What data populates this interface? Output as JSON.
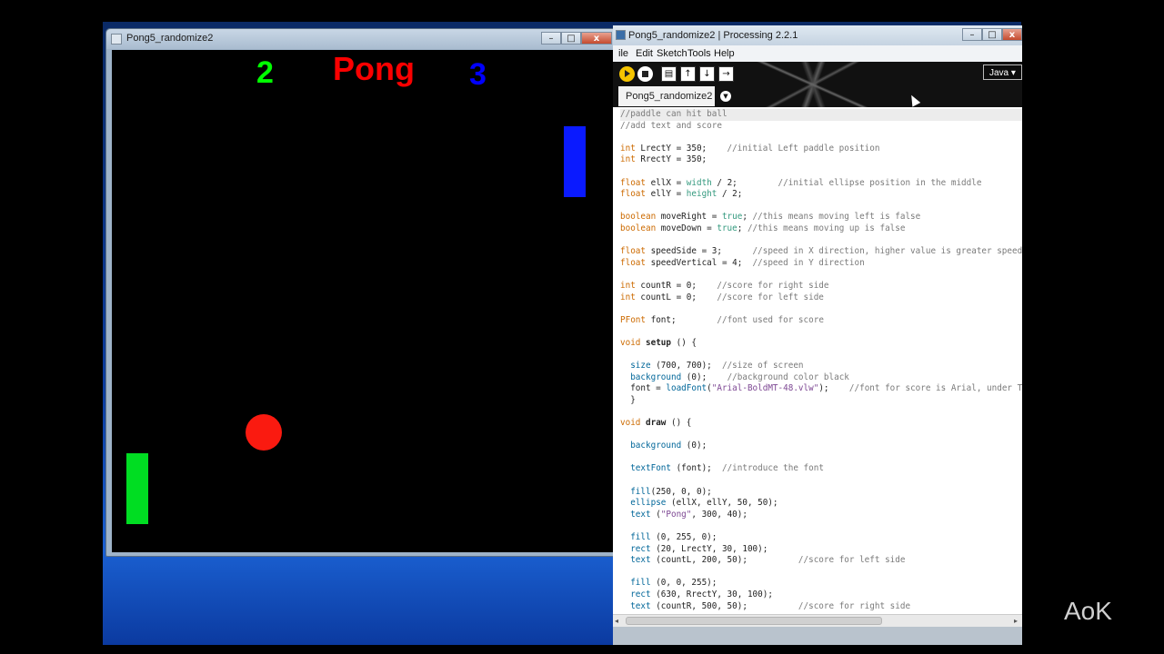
{
  "sketch_window": {
    "title": "Pong5_randomize2"
  },
  "game": {
    "title": "Pong",
    "score_left": "2",
    "score_right": "3"
  },
  "ide": {
    "title": "Pong5_randomize2 | Processing 2.2.1",
    "menu": [
      "ile",
      "Edit",
      "Sketch",
      "Tools",
      "Help"
    ],
    "mode": "Java ▾",
    "tab": "Pong5_randomize2",
    "code_lines": [
      [
        [
          "comment",
          "//paddle can hit ball"
        ]
      ],
      [
        [
          "comment",
          "//add text and score"
        ]
      ],
      [],
      [
        [
          "kw",
          "int"
        ],
        [
          "plain",
          " LrectY = 350;    "
        ],
        [
          "comment",
          "//initial Left paddle position"
        ]
      ],
      [
        [
          "kw",
          "int"
        ],
        [
          "plain",
          " RrectY = 350;"
        ]
      ],
      [],
      [
        [
          "kw",
          "float"
        ],
        [
          "plain",
          " ellX = "
        ],
        [
          "val",
          "width"
        ],
        [
          "plain",
          " / 2;        "
        ],
        [
          "comment",
          "//initial ellipse position in the middle"
        ]
      ],
      [
        [
          "kw",
          "float"
        ],
        [
          "plain",
          " ellY = "
        ],
        [
          "val",
          "height"
        ],
        [
          "plain",
          " / 2;"
        ]
      ],
      [],
      [
        [
          "kw",
          "boolean"
        ],
        [
          "plain",
          " moveRight = "
        ],
        [
          "val",
          "true"
        ],
        [
          "plain",
          "; "
        ],
        [
          "comment",
          "//this means moving left is false"
        ]
      ],
      [
        [
          "kw",
          "boolean"
        ],
        [
          "plain",
          " moveDown = "
        ],
        [
          "val",
          "true"
        ],
        [
          "plain",
          "; "
        ],
        [
          "comment",
          "//this means moving up is false"
        ]
      ],
      [],
      [
        [
          "kw",
          "float"
        ],
        [
          "plain",
          " speedSide = 3;      "
        ],
        [
          "comment",
          "//speed in X direction, higher value is greater speed"
        ]
      ],
      [
        [
          "kw",
          "float"
        ],
        [
          "plain",
          " speedVertical = 4;  "
        ],
        [
          "comment",
          "//speed in Y direction"
        ]
      ],
      [],
      [
        [
          "kw",
          "int"
        ],
        [
          "plain",
          " countR = 0;    "
        ],
        [
          "comment",
          "//score for right side"
        ]
      ],
      [
        [
          "kw",
          "int"
        ],
        [
          "plain",
          " countL = 0;    "
        ],
        [
          "comment",
          "//score for left side"
        ]
      ],
      [],
      [
        [
          "kw",
          "PFont"
        ],
        [
          "plain",
          " font;        "
        ],
        [
          "comment",
          "//font used for score"
        ]
      ],
      [],
      [
        [
          "kw",
          "void"
        ],
        [
          "plain",
          " "
        ],
        [
          "bold",
          "setup"
        ],
        [
          "plain",
          " () {"
        ]
      ],
      [],
      [
        [
          "plain",
          "  "
        ],
        [
          "fn",
          "size"
        ],
        [
          "plain",
          " (700, 700);  "
        ],
        [
          "comment",
          "//size of screen"
        ]
      ],
      [
        [
          "plain",
          "  "
        ],
        [
          "fn",
          "background"
        ],
        [
          "plain",
          " (0);    "
        ],
        [
          "comment",
          "//background color black"
        ]
      ],
      [
        [
          "plain",
          "  font = "
        ],
        [
          "fn",
          "loadFont"
        ],
        [
          "plain",
          "("
        ],
        [
          "str",
          "\"Arial-BoldMT-48.vlw\""
        ],
        [
          "plain",
          ");    "
        ],
        [
          "comment",
          "//font for score is Arial, under Tools"
        ]
      ],
      [
        [
          "plain",
          "  }"
        ]
      ],
      [],
      [
        [
          "kw",
          "void"
        ],
        [
          "plain",
          " "
        ],
        [
          "bold",
          "draw"
        ],
        [
          "plain",
          " () {"
        ]
      ],
      [],
      [
        [
          "plain",
          "  "
        ],
        [
          "fn",
          "background"
        ],
        [
          "plain",
          " (0);"
        ]
      ],
      [],
      [
        [
          "plain",
          "  "
        ],
        [
          "fn",
          "textFont"
        ],
        [
          "plain",
          " (font);  "
        ],
        [
          "comment",
          "//introduce the font"
        ]
      ],
      [],
      [
        [
          "plain",
          "  "
        ],
        [
          "fn",
          "fill"
        ],
        [
          "plain",
          "(250, 0, 0);"
        ]
      ],
      [
        [
          "plain",
          "  "
        ],
        [
          "fn",
          "ellipse"
        ],
        [
          "plain",
          " (ellX, ellY, 50, 50);"
        ]
      ],
      [
        [
          "plain",
          "  "
        ],
        [
          "fn",
          "text"
        ],
        [
          "plain",
          " ("
        ],
        [
          "str",
          "\"Pong\""
        ],
        [
          "plain",
          ", 300, 40);"
        ]
      ],
      [],
      [
        [
          "plain",
          "  "
        ],
        [
          "fn",
          "fill"
        ],
        [
          "plain",
          " (0, 255, 0);"
        ]
      ],
      [
        [
          "plain",
          "  "
        ],
        [
          "fn",
          "rect"
        ],
        [
          "plain",
          " (20, LrectY, 30, 100);"
        ]
      ],
      [
        [
          "plain",
          "  "
        ],
        [
          "fn",
          "text"
        ],
        [
          "plain",
          " (countL, 200, 50);          "
        ],
        [
          "comment",
          "//score for left side"
        ]
      ],
      [],
      [
        [
          "plain",
          "  "
        ],
        [
          "fn",
          "fill"
        ],
        [
          "plain",
          " (0, 0, 255);"
        ]
      ],
      [
        [
          "plain",
          "  "
        ],
        [
          "fn",
          "rect"
        ],
        [
          "plain",
          " (630, RrectY, 30, 100);"
        ]
      ],
      [
        [
          "plain",
          "  "
        ],
        [
          "fn",
          "text"
        ],
        [
          "plain",
          " (countR, 500, 50);          "
        ],
        [
          "comment",
          "//score for right side"
        ]
      ]
    ]
  },
  "watermark": "AoK",
  "colors": {
    "pong_red": "#fa0000",
    "paddle_green": "#00dd22",
    "paddle_blue": "#0a1aff"
  }
}
